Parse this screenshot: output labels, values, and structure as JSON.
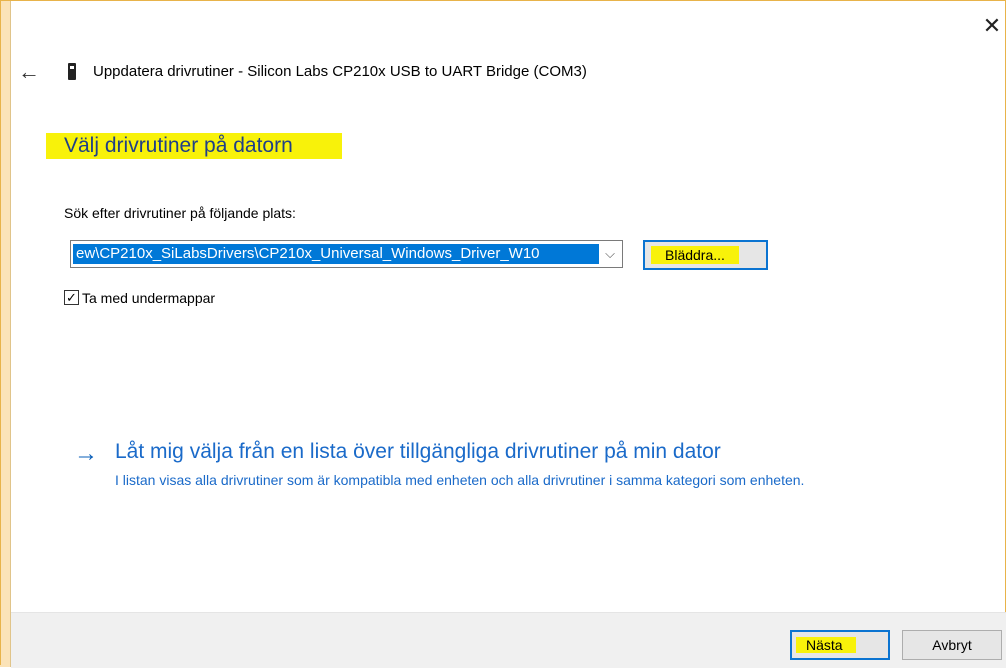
{
  "window": {
    "title": "Uppdatera drivrutiner - Silicon Labs CP210x USB to UART Bridge (COM3)",
    "close_glyph": "✕",
    "back_glyph": "←"
  },
  "heading": "Välj drivrutiner på datorn",
  "search": {
    "label": "Sök efter drivrutiner på följande plats:",
    "path_value": "ew\\CP210x_SiLabsDrivers\\CP210x_Universal_Windows_Driver_W10",
    "dropdown_glyph": "⌵",
    "browse_label": "Bläddra..."
  },
  "include_subfolders": {
    "checked": true,
    "check_glyph": "✓",
    "label": "Ta med undermappar"
  },
  "pick_from_list": {
    "arrow_glyph": "→",
    "link_text": "Låt mig välja från en lista över tillgängliga drivrutiner på min dator",
    "description": "I listan visas alla drivrutiner som är kompatibla med enheten och alla drivrutiner i samma kategori som enheten."
  },
  "footer": {
    "next_label": "Nästa",
    "cancel_label": "Avbryt"
  },
  "colors": {
    "highlight": "#f8f20a",
    "accent": "#0078d7",
    "link": "#1a6ac9",
    "heading": "#1f3f88"
  },
  "icons": {
    "device": "usb-device-icon",
    "back": "back-arrow-icon",
    "close": "close-icon",
    "dropdown": "chevron-down-icon",
    "checkbox": "checkbox-icon",
    "link": "arrow-right-icon"
  }
}
